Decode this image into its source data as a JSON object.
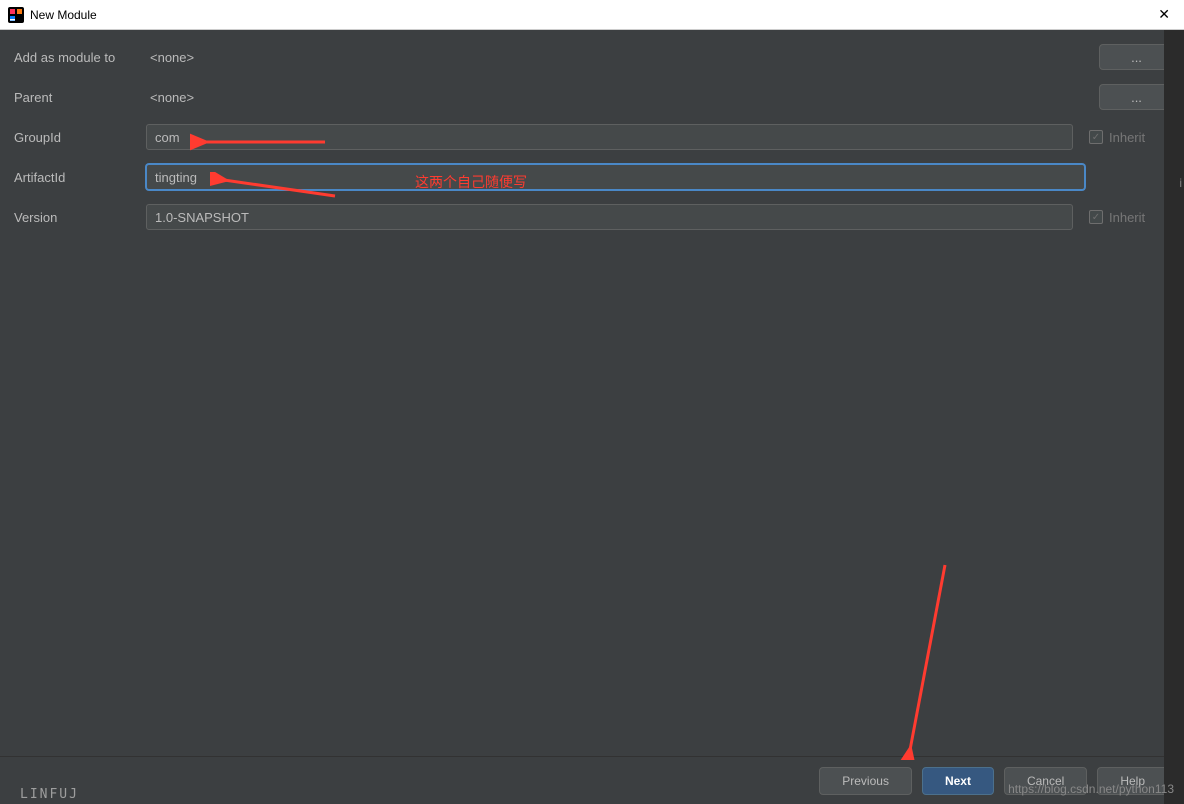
{
  "window": {
    "title": "New Module"
  },
  "form": {
    "add_as_module_label": "Add as module to",
    "add_as_module_value": "<none>",
    "parent_label": "Parent",
    "parent_value": "<none>",
    "groupid_label": "GroupId",
    "groupid_value": "com",
    "artifactid_label": "ArtifactId",
    "artifactid_value": "tingting",
    "version_label": "Version",
    "version_value": "1.0-SNAPSHOT",
    "inherit_label": "Inherit",
    "ellipsis": "..."
  },
  "footer": {
    "previous": "Previous",
    "next": "Next",
    "cancel": "Cancel",
    "help": "Help"
  },
  "annotations": {
    "text1": "这两个自己随便写"
  },
  "watermark": "https://blog.csdn.net/python113",
  "right_badge": "i",
  "bottom_strip": "LINFUJ"
}
